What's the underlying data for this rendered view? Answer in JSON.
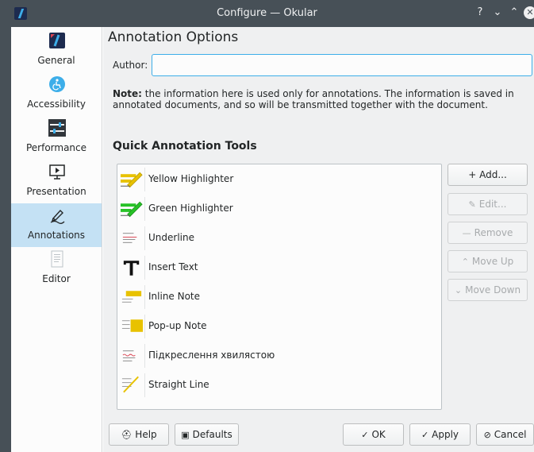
{
  "window": {
    "title": "Configure — Okular",
    "controls": [
      "?",
      "⌄",
      "⌃",
      "✕"
    ]
  },
  "sidebar": {
    "items": [
      {
        "label": "General",
        "icon": "okular-logo-icon"
      },
      {
        "label": "Accessibility",
        "icon": "accessibility-icon"
      },
      {
        "label": "Performance",
        "icon": "sliders-icon"
      },
      {
        "label": "Presentation",
        "icon": "presentation-screen-icon"
      },
      {
        "label": "Annotations",
        "icon": "pen-draw-icon",
        "selected": true
      },
      {
        "label": "Editor",
        "icon": "document-icon"
      }
    ]
  },
  "main": {
    "title": "Annotation Options",
    "author_label": "Author:",
    "author_value": "",
    "note_bold": "Note:",
    "note_text": " the information here is used only for annotations. The information is saved in annotated documents, and so will be transmitted together with the document.",
    "tools_title": "Quick Annotation Tools",
    "tools": [
      {
        "label": "Yellow Highlighter",
        "icon": "yellow-highlighter-icon"
      },
      {
        "label": "Green Highlighter",
        "icon": "green-highlighter-icon"
      },
      {
        "label": "Underline",
        "icon": "underline-icon"
      },
      {
        "label": "Insert Text",
        "icon": "insert-text-icon"
      },
      {
        "label": "Inline Note",
        "icon": "inline-note-icon"
      },
      {
        "label": "Pop-up Note",
        "icon": "popup-note-icon"
      },
      {
        "label": "Підкреслення хвилястою",
        "icon": "squiggly-underline-icon"
      },
      {
        "label": "Straight Line",
        "icon": "straight-line-icon"
      }
    ],
    "side_buttons": {
      "add": "+ Add...",
      "edit": "Edit...",
      "remove": "Remove",
      "move_up": "Move Up",
      "move_down": "Move Down"
    }
  },
  "footer": {
    "help": "Help",
    "defaults": "Defaults",
    "ok": "OK",
    "apply": "Apply",
    "cancel": "Cancel"
  },
  "colors": {
    "titlebar": "#475057",
    "selection": "#c4e1f4",
    "accent": "#3daee9",
    "highlighter_yellow": "#e8c200",
    "highlighter_green": "#27c227"
  }
}
